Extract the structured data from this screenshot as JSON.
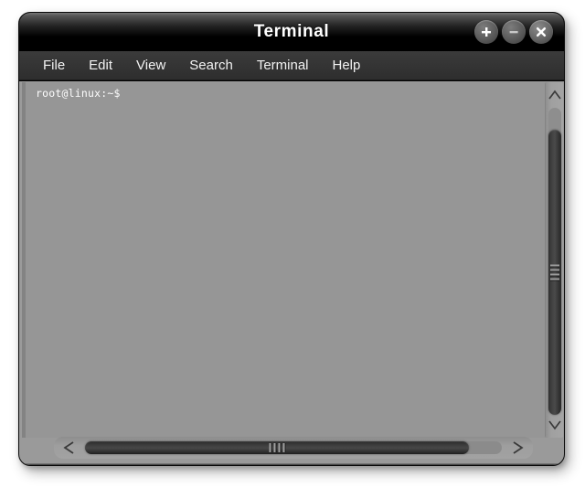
{
  "window": {
    "title": "Terminal",
    "controls": [
      {
        "name": "maximize-button",
        "glyph": "plus",
        "label": "+"
      },
      {
        "name": "minimize-button",
        "glyph": "minus",
        "label": "–"
      },
      {
        "name": "close-button",
        "glyph": "x",
        "label": "✕"
      }
    ]
  },
  "menubar": {
    "items": [
      {
        "label": "File"
      },
      {
        "label": "Edit"
      },
      {
        "label": "View"
      },
      {
        "label": "Search"
      },
      {
        "label": "Terminal"
      },
      {
        "label": "Help"
      }
    ]
  },
  "terminal": {
    "prompt": "root@linux:~$",
    "lines": [
      "root@linux:~$"
    ],
    "background_color": "#969696",
    "text_color": "#fdfdfd"
  },
  "scrollbars": {
    "vertical": {
      "up_arrow_icon": "chevron-up-icon",
      "down_arrow_icon": "chevron-down-icon",
      "thumb_grip_lines": 4
    },
    "horizontal": {
      "left_arrow_icon": "chevron-left-icon",
      "right_arrow_icon": "chevron-right-icon",
      "thumb_grip_lines": 4
    }
  },
  "theme": {
    "titlebar_top": "#777777",
    "titlebar_bottom": "#000000",
    "menubar": "#343434",
    "frame": "#9a9a9a",
    "desktop": "#ffffff"
  }
}
